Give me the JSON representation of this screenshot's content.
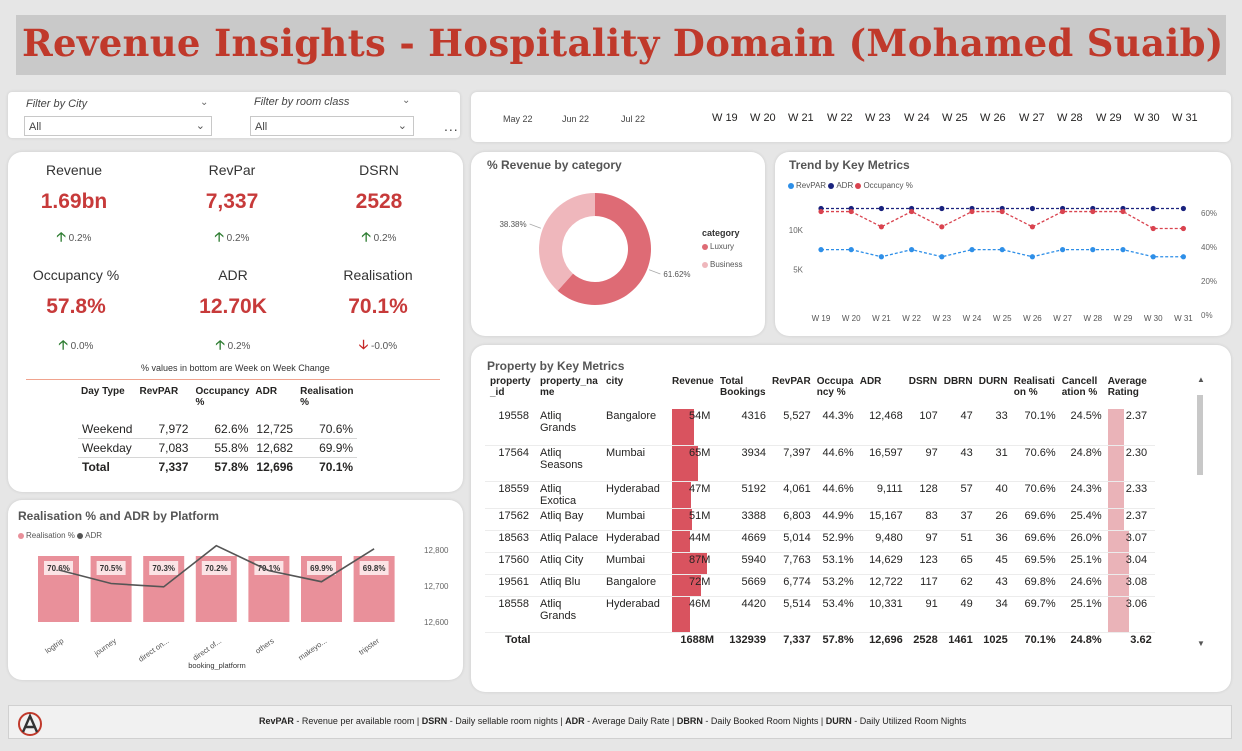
{
  "title": "Revenue Insights - Hospitality Domain (Mohamed Suaib)",
  "filters": {
    "city_label": "Filter by City",
    "city_value": "All",
    "room_label": "Filter by room class",
    "room_value": "All",
    "more": "..."
  },
  "timeline": {
    "months": [
      "May 22",
      "Jun 22",
      "Jul 22"
    ],
    "weeks": [
      "W 19",
      "W 20",
      "W 21",
      "W 22",
      "W 23",
      "W 24",
      "W 25",
      "W 26",
      "W 27",
      "W 28",
      "W 29",
      "W 30",
      "W 31"
    ]
  },
  "kpis": [
    {
      "label": "Revenue",
      "value": "1.69bn",
      "change": "0.2%",
      "direction": "up"
    },
    {
      "label": "RevPar",
      "value": "7,337",
      "change": "0.2%",
      "direction": "up"
    },
    {
      "label": "DSRN",
      "value": "2528",
      "change": "0.2%",
      "direction": "up"
    },
    {
      "label": "Occupancy %",
      "value": "57.8%",
      "change": "0.0%",
      "direction": "up"
    },
    {
      "label": "ADR",
      "value": "12.70K",
      "change": "0.2%",
      "direction": "up"
    },
    {
      "label": "Realisation",
      "value": "70.1%",
      "change": "-0.0%",
      "direction": "down"
    }
  ],
  "kpi_note": "% values in bottom are Week on Week Change",
  "daytype_table": {
    "headers": [
      "Day Type",
      "RevPAR",
      "Occupancy %",
      "ADR",
      "Realisation %"
    ],
    "rows": [
      [
        "Weekend",
        "7,972",
        "62.6%",
        "12,725",
        "70.6%"
      ],
      [
        "Weekday",
        "7,083",
        "55.8%",
        "12,682",
        "69.9%"
      ]
    ],
    "total": [
      "Total",
      "7,337",
      "57.8%",
      "12,696",
      "70.1%"
    ]
  },
  "donut": {
    "title": "% Revenue by category",
    "legend_title": "category",
    "colors": {
      "Luxury": "#de6b75",
      "Business": "#efb7bc"
    },
    "chart_data": {
      "type": "pie",
      "categories": [
        "Luxury",
        "Business"
      ],
      "values": [
        61.62,
        38.38
      ],
      "labels": [
        "61.62%",
        "38.38%"
      ]
    }
  },
  "trend": {
    "title": "Trend by Key Metrics",
    "legend": [
      "RevPAR",
      "ADR",
      "Occupancy %"
    ],
    "colors": {
      "RevPAR": "#2e8fe8",
      "ADR": "#1a237e",
      "Occupancy %": "#d9434f"
    },
    "left_ticks": [
      "10K",
      "5K"
    ],
    "right_ticks": [
      "60%",
      "40%",
      "20%",
      "0%"
    ],
    "chart_data": {
      "type": "line",
      "x": [
        "W 19",
        "W 20",
        "W 21",
        "W 22",
        "W 23",
        "W 24",
        "W 25",
        "W 26",
        "W 27",
        "W 28",
        "W 29",
        "W 30",
        "W 31"
      ],
      "series": [
        {
          "name": "RevPAR",
          "axis": "left",
          "values": [
            7500,
            7500,
            6600,
            7500,
            6600,
            7500,
            7500,
            6600,
            7500,
            7500,
            7500,
            6600,
            6600
          ]
        },
        {
          "name": "ADR",
          "axis": "left",
          "values": [
            12700,
            12700,
            12700,
            12700,
            12700,
            12700,
            12700,
            12700,
            12700,
            12700,
            12700,
            12700,
            12700
          ]
        },
        {
          "name": "Occupancy %",
          "axis": "right",
          "values": [
            61,
            61,
            52,
            61,
            52,
            61,
            61,
            52,
            61,
            61,
            61,
            51,
            51
          ]
        }
      ],
      "ylim_left": [
        0,
        15000
      ],
      "ylim_right": [
        0,
        70
      ]
    }
  },
  "platform": {
    "title": "Realisation % and ADR by Platform",
    "legend": [
      "Realisation %",
      "ADR"
    ],
    "colors": {
      "bar": "#e9909a",
      "line": "#555555"
    },
    "xlabel": "booking_platform",
    "right_ticks": [
      "12,800",
      "12,700",
      "12,600"
    ],
    "chart_data": {
      "type": "bar",
      "categories": [
        "logtrip",
        "journey",
        "direct on...",
        "direct of...",
        "others",
        "makeyo...",
        "tripster"
      ],
      "series": [
        {
          "name": "Realisation %",
          "values": [
            70.6,
            70.5,
            70.3,
            70.2,
            70.1,
            69.9,
            69.8
          ],
          "labels": [
            "70.6%",
            "70.5%",
            "70.3%",
            "70.2%",
            "70.1%",
            "69.9%",
            "69.8%"
          ]
        },
        {
          "name": "ADR",
          "values": [
            12706,
            12653,
            12640,
            12800,
            12703,
            12660,
            12788
          ]
        }
      ],
      "ylim_right": [
        12550,
        12830
      ]
    }
  },
  "property": {
    "title": "Property by Key Metrics",
    "headers": [
      "property _id",
      "property_na me",
      "city",
      "Revenue",
      "Total Bookings",
      "RevPAR",
      "Occupa ncy %",
      "ADR",
      "DSRN",
      "DBRN",
      "DURN",
      "Realisati on %",
      "Cancell ation %",
      "Average Rating"
    ],
    "rows": [
      {
        "id": "19558",
        "name": "Atliq Grands",
        "city": "Bangalore",
        "revenue": "54M",
        "rev_val": 54,
        "bookings": "4316",
        "revpar": "5,527",
        "occ": "44.3%",
        "adr": "12,468",
        "dsrn": "107",
        "dbrn": "47",
        "durn": "33",
        "real": "70.1%",
        "cancel": "24.5%",
        "rating": "2.37",
        "rating_val": 2.37
      },
      {
        "id": "17564",
        "name": "Atliq Seasons",
        "city": "Mumbai",
        "revenue": "65M",
        "rev_val": 65,
        "bookings": "3934",
        "revpar": "7,397",
        "occ": "44.6%",
        "adr": "16,597",
        "dsrn": "97",
        "dbrn": "43",
        "durn": "31",
        "real": "70.6%",
        "cancel": "24.8%",
        "rating": "2.30",
        "rating_val": 2.3
      },
      {
        "id": "18559",
        "name": "Atliq Exotica",
        "city": "Hyderabad",
        "revenue": "47M",
        "rev_val": 47,
        "bookings": "5192",
        "revpar": "4,061",
        "occ": "44.6%",
        "adr": "9,111",
        "dsrn": "128",
        "dbrn": "57",
        "durn": "40",
        "real": "70.6%",
        "cancel": "24.3%",
        "rating": "2.33",
        "rating_val": 2.33
      },
      {
        "id": "17562",
        "name": "Atliq Bay",
        "city": "Mumbai",
        "revenue": "51M",
        "rev_val": 51,
        "bookings": "3388",
        "revpar": "6,803",
        "occ": "44.9%",
        "adr": "15,167",
        "dsrn": "83",
        "dbrn": "37",
        "durn": "26",
        "real": "69.6%",
        "cancel": "25.4%",
        "rating": "2.37",
        "rating_val": 2.37
      },
      {
        "id": "18563",
        "name": "Atliq Palace",
        "city": "Hyderabad",
        "revenue": "44M",
        "rev_val": 44,
        "bookings": "4669",
        "revpar": "5,014",
        "occ": "52.9%",
        "adr": "9,480",
        "dsrn": "97",
        "dbrn": "51",
        "durn": "36",
        "real": "69.6%",
        "cancel": "26.0%",
        "rating": "3.07",
        "rating_val": 3.07
      },
      {
        "id": "17560",
        "name": "Atliq City",
        "city": "Mumbai",
        "revenue": "87M",
        "rev_val": 87,
        "bookings": "5940",
        "revpar": "7,763",
        "occ": "53.1%",
        "adr": "14,629",
        "dsrn": "123",
        "dbrn": "65",
        "durn": "45",
        "real": "69.5%",
        "cancel": "25.1%",
        "rating": "3.04",
        "rating_val": 3.04
      },
      {
        "id": "19561",
        "name": "Atliq Blu",
        "city": "Bangalore",
        "revenue": "72M",
        "rev_val": 72,
        "bookings": "5669",
        "revpar": "6,774",
        "occ": "53.2%",
        "adr": "12,722",
        "dsrn": "117",
        "dbrn": "62",
        "durn": "43",
        "real": "69.8%",
        "cancel": "24.6%",
        "rating": "3.08",
        "rating_val": 3.08
      },
      {
        "id": "18558",
        "name": "Atliq Grands",
        "city": "Hyderabad",
        "revenue": "46M",
        "rev_val": 46,
        "bookings": "4420",
        "revpar": "5,514",
        "occ": "53.4%",
        "adr": "10,331",
        "dsrn": "91",
        "dbrn": "49",
        "durn": "34",
        "real": "69.7%",
        "cancel": "25.1%",
        "rating": "3.06",
        "rating_val": 3.06
      }
    ],
    "total": {
      "label": "Total",
      "revenue": "1688M",
      "bookings": "132939",
      "revpar": "7,337",
      "occ": "57.8%",
      "adr": "12,696",
      "dsrn": "2528",
      "dbrn": "1461",
      "durn": "1025",
      "real": "70.1%",
      "cancel": "24.8%",
      "rating": "3.62"
    }
  },
  "footer": {
    "items": [
      {
        "abbr": "RevPAR",
        "desc": " - Revenue per available room | "
      },
      {
        "abbr": "DSRN",
        "desc": " - Daily sellable room nights | "
      },
      {
        "abbr": "ADR",
        "desc": " - Average Daily Rate | "
      },
      {
        "abbr": "DBRN",
        "desc": " - Daily Booked Room Nights | "
      },
      {
        "abbr": "DURN",
        "desc": " - Daily Utilized Room Nights"
      }
    ]
  }
}
